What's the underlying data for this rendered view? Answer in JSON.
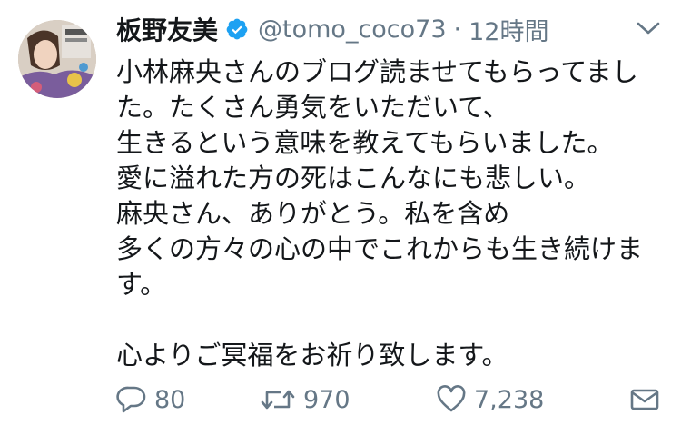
{
  "tweet": {
    "author": {
      "name": "板野友美",
      "handle": "@tomo_coco73",
      "separator": "·",
      "time": "12時間",
      "avatar_icon": "profile-photo"
    },
    "text_lines": [
      "小林麻央さんのブログ読ませてもらってまし",
      "た。たくさん勇気をいただいて、",
      "生きるという意味を教えてもらいました。",
      "愛に溢れた方の死はこんなにも悲しい。",
      "麻央さん、ありがとう。私を含め",
      "多くの方々の心の中でこれからも生き続けま",
      "す。",
      "",
      "心よりご冥福をお祈り致します。"
    ],
    "actions": {
      "reply_count": "80",
      "retweet_count": "970",
      "like_count": "7,238"
    },
    "icons": {
      "verified": "verified-badge-icon",
      "menu": "chevron-down-icon",
      "reply": "reply-icon",
      "retweet": "retweet-icon",
      "like": "heart-icon",
      "dm": "envelope-icon"
    },
    "colors": {
      "verified": "#1da1f2",
      "text": "#14171a",
      "muted": "#657786"
    }
  }
}
